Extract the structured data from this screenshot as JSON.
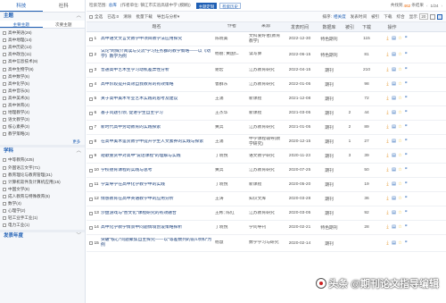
{
  "sidebar": {
    "top_tabs": [
      "科技",
      "社科"
    ],
    "topic_section": {
      "title": "主题",
      "subtabs": [
        "主要主题",
        "次要主题"
      ]
    },
    "topics": [
      "高中英语(26)",
      "高中地理(14)",
      "高中历史(12)",
      "高中政治(11)",
      "高中信息技术(9)",
      "高中生物学(8)",
      "高中数学(6)",
      "高中化学(5)",
      "高中音乐(5)",
      "高中美术(5)",
      "高中体育(4)",
      "地理教学(4)",
      "语文教学(3)",
      "核心素养(3)",
      "教学策略(3)"
    ],
    "more": "更多",
    "discipline_section": {
      "title": "学科"
    },
    "disciplines": [
      "中等教育(425)",
      "外国语言文字(71)",
      "教育理论与教育管理(31)",
      "计算机软件及计算机应用(15)",
      "中国文学(8)",
      "成人教育与特殊教育(6)",
      "数学(4)",
      "心理学(2)",
      "轻工业手工业(1)",
      "电力工业(1)"
    ],
    "year_section": {
      "title": "发表年度"
    }
  },
  "searchbar": {
    "label": "检索范围:",
    "scope": "总库",
    "query": "(作者单位: 镇江市实验高级中学 (模糊))",
    "btn_topic": "主题定制",
    "btn_history": "检索历史",
    "total_label": "共找到",
    "total": "462",
    "total_unit": "条结果",
    "page": "1/24"
  },
  "toolbar": {
    "select_all": "全选",
    "selected_label": "已选:",
    "selected_count": "0",
    "clear": "清除",
    "batch_download": "批量下载",
    "export": "导出与分析",
    "sort_label": "排序:",
    "sort_options": [
      "相关度",
      "发表时间",
      "被引",
      "下载",
      "综合"
    ],
    "sort_active": "相关度",
    "display_label": "显示",
    "page_size": "20"
  },
  "table": {
    "headers": {
      "title": "题名",
      "author": "作者",
      "source": "来源",
      "date": "发表时间",
      "database": "数据库",
      "cited": "被引",
      "downloads": "下载",
      "ops": "操作"
    },
    "rows": [
      {
        "no": "1",
        "title": "高中语文文言文教学中项目教学法应用探究",
        "author": "陈晓美",
        "source": "文科爱好者(教育教学)",
        "date": "2022-12-30",
        "db": "特色期刊",
        "cited": "",
        "dl": "115"
      },
      {
        "no": "2",
        "title": "试论“跨媒介阅读与交流”学习任务群的教学策略——以《劝学》教学为例",
        "author": "杨丽; 黄国仁",
        "source": "读写算",
        "date": "2022-06-15",
        "db": "特色期刊",
        "cited": "",
        "dl": "81"
      },
      {
        "no": "3",
        "title": "普通高中艺术生学习动机差异性分析",
        "author": "谢宏",
        "source": "江苏教育研究",
        "date": "2022-04-15",
        "db": "期刊",
        "cited": "",
        "dl": "210"
      },
      {
        "no": "4",
        "title": "高中阶段提升高效自我教育的有效策略",
        "author": "鲁群东",
        "source": "江苏教育研究",
        "date": "2022-01-05",
        "db": "期刊",
        "cited": "",
        "dl": "98"
      },
      {
        "no": "5",
        "title": "关于高中美术专业艺术实践的思考及建议",
        "author": "王涌",
        "source": "新课程",
        "date": "2021-12-08",
        "db": "期刊",
        "cited": "",
        "dl": "72"
      },
      {
        "no": "6",
        "title": "基于问题引领, 促进学生自主学习",
        "author": "王杰华",
        "source": "新课程",
        "date": "2021-03-05",
        "db": "期刊",
        "cited": "2",
        "dl": "44"
      },
      {
        "no": "7",
        "title": "新时代高中劳动教育的实践探索",
        "author": "黄兵",
        "source": "江苏教育研究",
        "date": "2021-01-05",
        "db": "期刊",
        "cited": "2",
        "dl": "89"
      },
      {
        "no": "8",
        "title": "在高中美术鉴赏教学中提升学生人文素养的实践与探索",
        "author": "王涌",
        "source": "中学课程辅导(教学研究)",
        "date": "2020-12-15",
        "db": "期刊",
        "cited": "1",
        "dl": "27"
      },
      {
        "no": "9",
        "title": "短歌重赏中对高中“说话课程”的理解与实践",
        "author": "丁晓悦",
        "source": "语文教学研究",
        "date": "2020-11-23",
        "db": "期刊",
        "cited": "3",
        "dl": "39"
      },
      {
        "no": "10",
        "title": "学校德育课程的实践与思考",
        "author": "黄兵",
        "source": "江苏教育研究",
        "date": "2020-07-25",
        "db": "期刊",
        "cited": "",
        "dl": "50"
      },
      {
        "no": "11",
        "title": "学案导学在高中化学教学中的实践",
        "author": "丁晓悦",
        "source": "新课程",
        "date": "2020-05-20",
        "db": "期刊",
        "cited": "",
        "dl": "19"
      },
      {
        "no": "12",
        "title": "情感教育在高中英语教学中的应用分析",
        "author": "王涛",
        "source": "知识文库",
        "date": "2020-03-28",
        "db": "期刊",
        "cited": "",
        "dl": "36"
      },
      {
        "no": "13",
        "title": "沙盘游戏与“善文化”课程研究的有效融合",
        "author": "王彬; 陈红",
        "source": "江苏教育研究",
        "date": "2020-03-05",
        "db": "期刊",
        "cited": "",
        "dl": "92"
      },
      {
        "no": "14",
        "title": "高中化学教学情景中问题情境创设策略探析",
        "author": "丁晓悦",
        "source": "学问导刊",
        "date": "2020-02-21",
        "db": "特色期刊",
        "cited": "",
        "dl": "28"
      },
      {
        "no": "15",
        "title": "突破“核心”问题聚焦自主探究——以“等差数列的前n项和”为例",
        "author": "杨慧",
        "source": "数学学习与研究",
        "date": "2020-02-14",
        "db": "期刊",
        "cited": "",
        "dl": ""
      }
    ]
  },
  "watermark": "头条 @期刊论文指导编辑",
  "icons": {
    "download": "download-icon",
    "read": "read-icon",
    "favorite": "star-icon",
    "cite": "quote-icon"
  },
  "colors": {
    "accent": "#1f5fb4",
    "count": "#e66600"
  }
}
